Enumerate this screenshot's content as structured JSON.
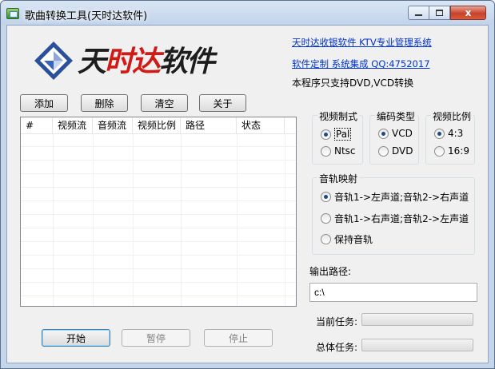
{
  "window": {
    "title": "歌曲转换工具(天时达软件)",
    "close_symbol": "x"
  },
  "logo": {
    "text_black_1": "天",
    "text_red": "时达",
    "text_black_2": "软件",
    "colors": {
      "red": "#d11a15",
      "blue": "#2a4f9b",
      "dark": "#1d1d1d"
    }
  },
  "links": {
    "company": "天时达收银软件 KTV专业管理系统",
    "custom": "软件定制 系统集成 QQ:4752017"
  },
  "notice": "本程序只支持DVD,VCD转换",
  "toolbar": {
    "add": "添加",
    "delete": "删除",
    "clear": "清空",
    "about": "关于"
  },
  "list": {
    "columns": [
      "#",
      "视频流",
      "音频流",
      "视频比例",
      "路径",
      "状态"
    ],
    "rows": []
  },
  "video_format": {
    "label": "视频制式",
    "options": [
      {
        "label": "Pal",
        "checked": true
      },
      {
        "label": "Ntsc",
        "checked": false
      }
    ]
  },
  "encode_type": {
    "label": "编码类型",
    "options": [
      {
        "label": "VCD",
        "checked": true
      },
      {
        "label": "DVD",
        "checked": false
      }
    ]
  },
  "aspect": {
    "label": "视频比例",
    "options": [
      {
        "label": "4:3",
        "checked": true
      },
      {
        "label": "16:9",
        "checked": false
      }
    ]
  },
  "audio_map": {
    "label": "音轨映射",
    "options": [
      {
        "label": "音轨1->左声道;音轨2->右声道",
        "checked": true
      },
      {
        "label": "音轨1->右声道;音轨2->左声道",
        "checked": false
      },
      {
        "label": "保持音轨",
        "checked": false
      }
    ]
  },
  "output": {
    "label": "输出路径:",
    "value": "c:\\"
  },
  "progress": {
    "current_label": "当前任务:",
    "current_value": 0,
    "total_label": "总体任务:",
    "total_value": 0
  },
  "actions": {
    "start": "开始",
    "pause": "暂停",
    "stop": "停止"
  }
}
